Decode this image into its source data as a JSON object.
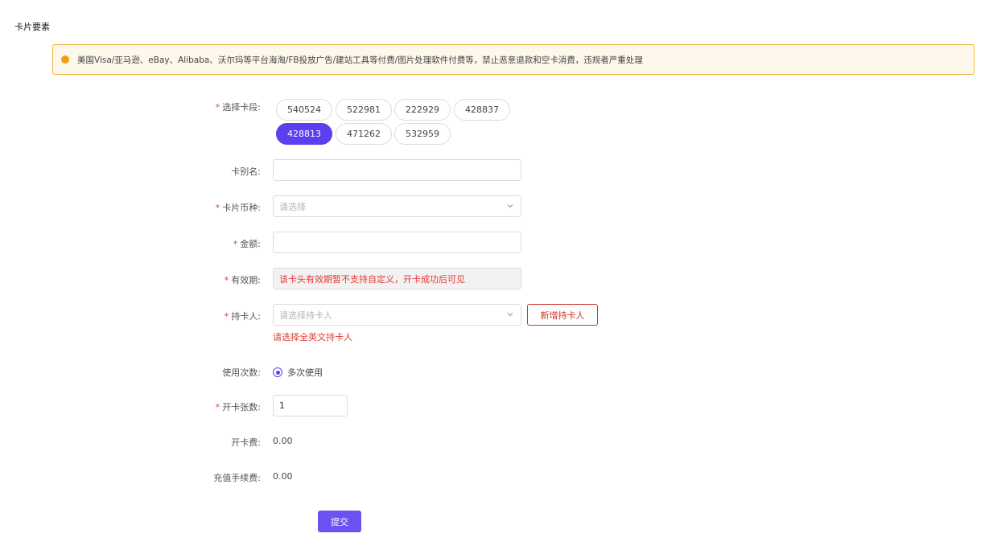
{
  "section_title": "卡片要素",
  "notice": {
    "text": "美国Visa/亚马逊、eBay、Alibaba、沃尔玛等平台海淘/FB投放广告/建站工具等付费/图片处理软件付费等，禁止恶意退款和空卡消费，违规者严重处理",
    "icon": "warning-dot-icon",
    "color": "#f39c12"
  },
  "card_segment": {
    "label": "选择卡段:",
    "required": "*",
    "options": [
      "540524",
      "522981",
      "222929",
      "428837",
      "428813",
      "471262",
      "532959"
    ],
    "selected": "428813"
  },
  "card_alias": {
    "label": "卡别名:",
    "value": ""
  },
  "currency": {
    "label": "卡片币种:",
    "required": "*",
    "placeholder": "请选择"
  },
  "amount": {
    "label": "金额:",
    "required": "*",
    "value": ""
  },
  "validity": {
    "label": "有效期:",
    "required": "*",
    "value": "该卡头有效期暂不支持自定义，开卡成功后可见"
  },
  "cardholder": {
    "label": "持卡人:",
    "required": "*",
    "placeholder": "请选择持卡人",
    "add_button": "新增持卡人",
    "error": "请选择全英文持卡人"
  },
  "usage": {
    "label": "使用次数:",
    "option": "多次使用"
  },
  "card_count": {
    "label": "开卡张数:",
    "required": "*",
    "value": "1"
  },
  "open_fee": {
    "label": "开卡费:",
    "value": "0.00"
  },
  "recharge_fee": {
    "label": "充值手续费:",
    "value": "0.00"
  },
  "submit_label": "提交",
  "colors": {
    "accent": "#5b3ff0",
    "error": "#e53935",
    "warning": "#f0b23a"
  }
}
